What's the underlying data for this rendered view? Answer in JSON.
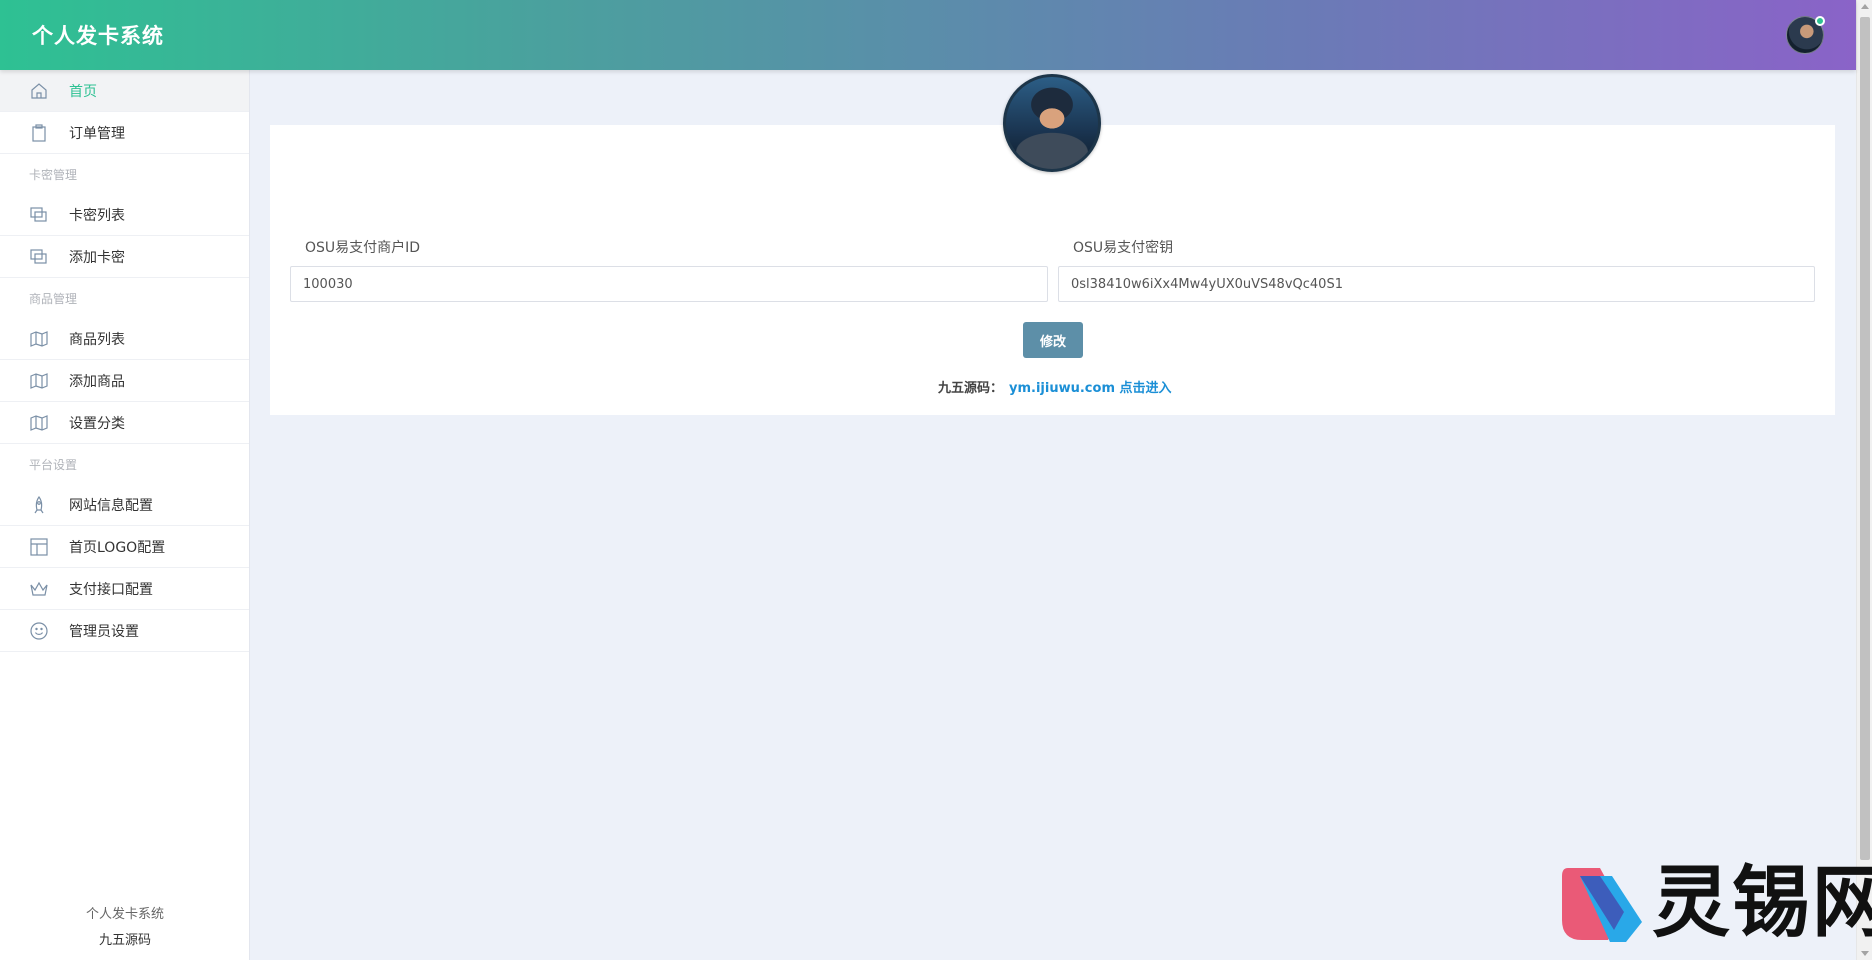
{
  "header": {
    "title": "个人发卡系统"
  },
  "sidebar": {
    "items": [
      {
        "label": "首页",
        "icon": "home-icon",
        "active": true
      },
      {
        "label": "订单管理",
        "icon": "clipboard-icon"
      },
      {
        "group": "卡密管理"
      },
      {
        "label": "卡密列表",
        "icon": "cards-icon"
      },
      {
        "label": "添加卡密",
        "icon": "cards-icon"
      },
      {
        "group": "商品管理"
      },
      {
        "label": "商品列表",
        "icon": "map-icon"
      },
      {
        "label": "添加商品",
        "icon": "map-icon"
      },
      {
        "label": "设置分类",
        "icon": "map-icon"
      },
      {
        "group": "平台设置"
      },
      {
        "label": "网站信息配置",
        "icon": "rocket-icon"
      },
      {
        "label": "首页LOGO配置",
        "icon": "layout-icon"
      },
      {
        "label": "支付接口配置",
        "icon": "crown-icon"
      },
      {
        "label": "管理员设置",
        "icon": "smile-icon"
      }
    ],
    "footer": {
      "line1": "个人发卡系统",
      "line2": "九五源码"
    }
  },
  "form": {
    "merchant_id_label": "OSU易支付商户ID",
    "merchant_id_value": "100030",
    "secret_label": "OSU易支付密钥",
    "secret_value": "0sl38410w6iXx4Mw4yUX0uVS48vQc40S1",
    "submit_label": "修改"
  },
  "credit": {
    "prefix": "九五源码：",
    "link_text": "ym.ijiuwu.com 点击进入"
  },
  "watermark": {
    "text": "灵锡网"
  },
  "colors": {
    "accent": "#2ec193",
    "button": "#5d8fa8",
    "link": "#1b8fd6",
    "background": "#edf1f9"
  }
}
